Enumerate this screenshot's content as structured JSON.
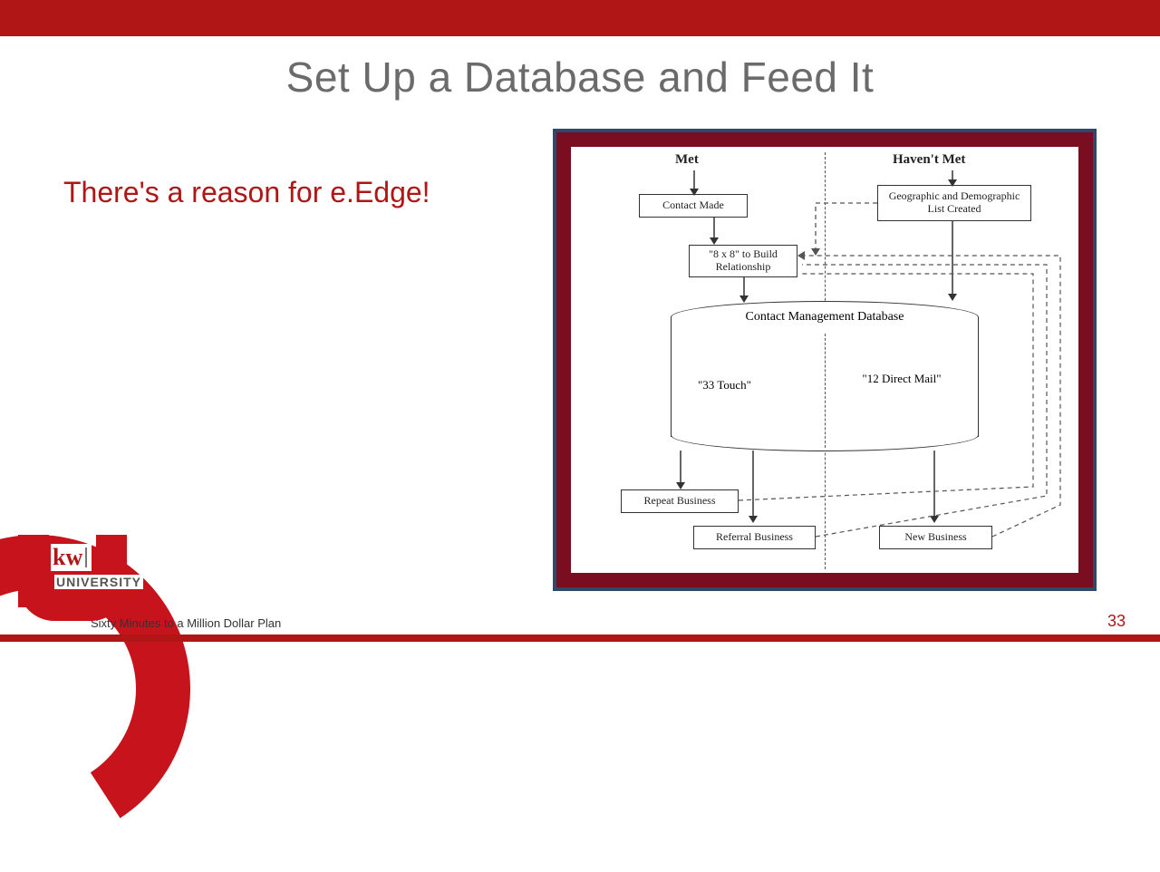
{
  "header": {
    "title": "Set Up a Database and Feed It"
  },
  "left": {
    "text": "There's a reason for e.Edge!"
  },
  "diagram": {
    "col_left_header": "Met",
    "col_right_header": "Haven't Met",
    "contact_made": "Contact Made",
    "geo_demo": "Geographic and Demographic List Created",
    "eight_by_eight": "\"8 x 8\" to Build Relationship",
    "cylinder_title": "Contact Management Database",
    "touch33": "\"33 Touch\"",
    "direct12": "\"12 Direct Mail\"",
    "repeat": "Repeat Business",
    "referral": "Referral Business",
    "newbiz": "New Business"
  },
  "logo": {
    "kw": "kw",
    "university": "UNIVERSITY"
  },
  "footer": {
    "course": "Sixty Minutes to a Million Dollar Plan",
    "page": "33"
  },
  "colors": {
    "brand_red": "#b01616",
    "frame_navy": "#2e4a6b",
    "frame_maroon": "#7a0d1f"
  }
}
